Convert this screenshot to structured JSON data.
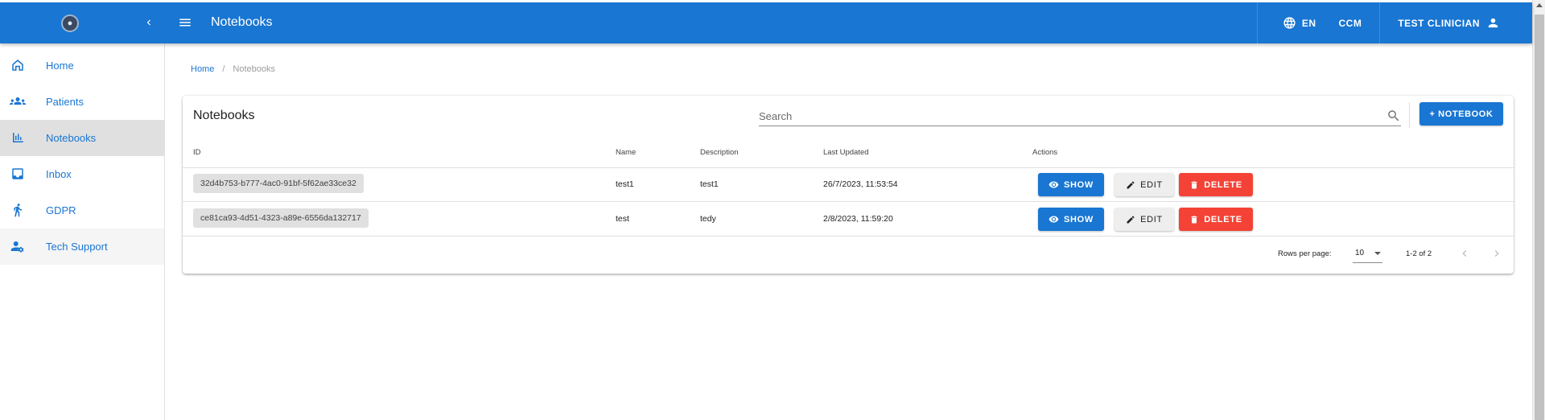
{
  "appbar": {
    "title": "Notebooks",
    "language": "EN",
    "organization": "CCM",
    "user": "TEST CLINICIAN",
    "color": "#1976d2"
  },
  "sidebar": {
    "items": [
      {
        "label": "Home",
        "icon": "home-icon"
      },
      {
        "label": "Patients",
        "icon": "people-icon"
      },
      {
        "label": "Notebooks",
        "icon": "bar-chart-icon",
        "active": true
      },
      {
        "label": "Inbox",
        "icon": "inbox-icon"
      },
      {
        "label": "GDPR",
        "icon": "gdpr-icon"
      },
      {
        "label": "Tech Support",
        "icon": "support-icon"
      }
    ]
  },
  "breadcrumb": {
    "home": "Home",
    "separator": "/",
    "current": "Notebooks"
  },
  "card": {
    "title": "Notebooks",
    "search_placeholder": "Search",
    "add_button": "+ NOTEBOOK"
  },
  "table": {
    "headers": [
      "ID",
      "Name",
      "Description",
      "Last Updated",
      "Actions"
    ],
    "rows": [
      {
        "id": "32d4b753-b777-4ac0-91bf-5f62ae33ce32",
        "name": "test1",
        "description": "test1",
        "updated": "26/7/2023, 11:53:54"
      },
      {
        "id": "ce81ca93-4d51-4323-a89e-6556da132717",
        "name": "test",
        "description": "tedy",
        "updated": "2/8/2023, 11:59:20"
      }
    ],
    "actions": {
      "show": "SHOW",
      "edit": "EDIT",
      "delete": "DELETE"
    }
  },
  "pagination": {
    "rows_per_page_label": "Rows per page:",
    "rows_per_page": "10",
    "range": "1-2 of 2"
  },
  "colors": {
    "primary": "#1976d2",
    "danger": "#f44336",
    "active_bg": "#e0e0e0"
  }
}
